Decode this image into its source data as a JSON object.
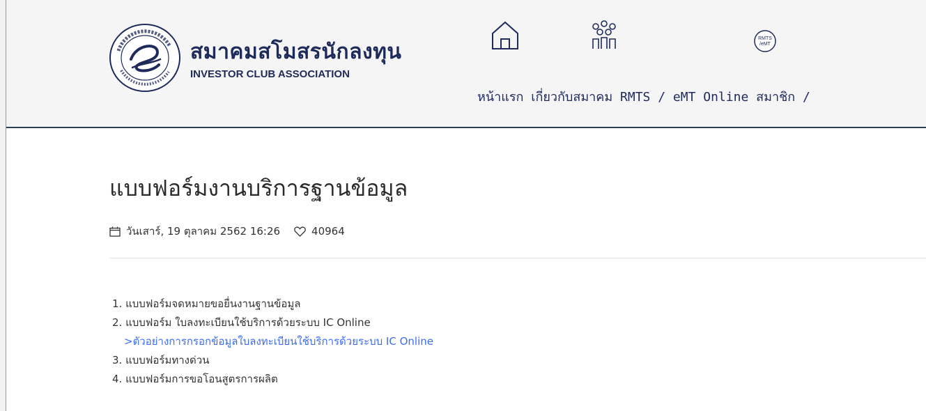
{
  "header": {
    "logo": {
      "thai_name": "สมาคมสโมสรนักลงทุน",
      "english_name": "INVESTOR CLUB ASSOCIATION",
      "seal_text": "สมาคมสโมสรนักลงทุน INVESTOR CLUB ASSOCIATION"
    },
    "nav": [
      {
        "label": "หน้าแรก",
        "icon": "home-icon"
      },
      {
        "label": "เกี่ยวกับสมาคม",
        "icon": "people-group-icon"
      },
      {
        "label": "RMTS / eMT Online",
        "icon": "rmts-emt-icon",
        "icon_text": "RMTS /eMT"
      },
      {
        "label": "สมาชิก /",
        "icon": ""
      }
    ],
    "colors": {
      "brand": "#1e2a5a",
      "header_bg": "#f5f5f5",
      "header_border": "#2c3e50"
    }
  },
  "article": {
    "title": "แบบฟอร์มงานบริการฐานข้อมูล",
    "date": "วันเสาร์, 19 ตุลาคม 2562 16:26",
    "likes": "40964",
    "items": [
      {
        "text": "1. แบบฟอร์มจดหมายขอยื่นงานฐานข้อมูล",
        "is_link": false
      },
      {
        "text": "2. แบบฟอร์ม ใบลงทะเบียนใช้บริการด้วยระบบ IC Online",
        "is_link": false
      },
      {
        "text": ">ตัวอย่างการกรอกข้อมูลใบลงทะเบียนใช้บริการด้วยระบบ IC Online",
        "is_link": true
      },
      {
        "text": "3. แบบฟอร์มทางด่วน",
        "is_link": false
      },
      {
        "text": "4. แบบฟอร์มการขอโอนสูตรการผลิต",
        "is_link": false
      }
    ],
    "colors": {
      "link": "#3d6cf2",
      "text": "#333333"
    }
  }
}
